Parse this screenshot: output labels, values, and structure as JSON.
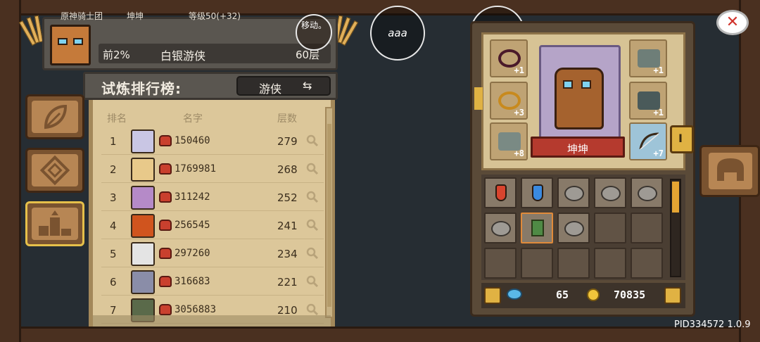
{
  "player": {
    "guild": "原神骑士团",
    "name": "坤坤",
    "level": "等级50(+32)",
    "rank_percent": "前2%",
    "title": "白银游侠",
    "floor": "60层"
  },
  "leaderboard": {
    "title": "试炼排行榜:",
    "class_button": "游侠",
    "columns": {
      "rank": "排名",
      "name": "名字",
      "floor": "层数"
    },
    "rows": [
      {
        "rank": "1",
        "name": "150460",
        "floor": "279"
      },
      {
        "rank": "2",
        "name": "1769981",
        "floor": "268"
      },
      {
        "rank": "3",
        "name": "311242",
        "floor": "252"
      },
      {
        "rank": "4",
        "name": "256545",
        "floor": "241"
      },
      {
        "rank": "5",
        "name": "297260",
        "floor": "234"
      },
      {
        "rank": "6",
        "name": "316683",
        "floor": "221"
      },
      {
        "rank": "7",
        "name": "3056883",
        "floor": "210"
      }
    ]
  },
  "overlay_circles": {
    "small": "移动。",
    "aaa": "aaa",
    "move": "移动"
  },
  "equipment": {
    "hero_name": "坤坤",
    "slots": [
      "+1",
      "+3",
      "+8",
      "+1",
      "+1",
      "+7"
    ],
    "tab_label": "I"
  },
  "currency": {
    "gems": "65",
    "coins": "70835"
  },
  "version": "PID334572 1.0.9",
  "icons": {
    "close": "x-icon",
    "refresh": "swap-icon",
    "search": "magnifier-icon",
    "lock": "lock-icon",
    "grid": "grid-icon",
    "leaf": "leaf-icon",
    "diamond": "diamond-icon",
    "podium": "podium-icon",
    "helmet": "helmet-icon"
  },
  "colors": {
    "accent_gold": "#e0b243",
    "ribbon_red": "#b53a2e",
    "panel_parchment": "#dcc79a"
  }
}
